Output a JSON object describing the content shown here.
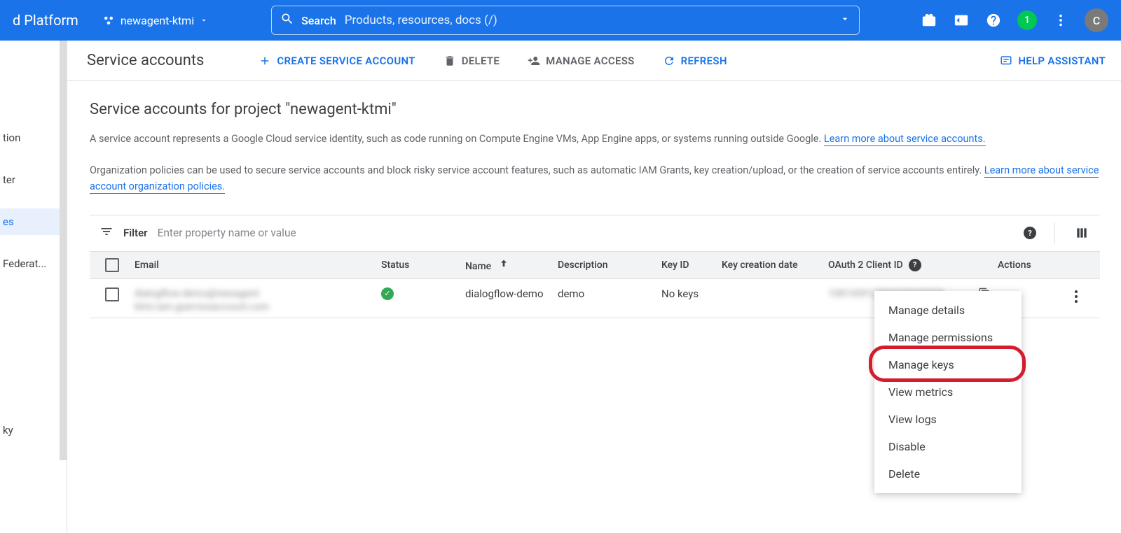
{
  "header": {
    "platform": "d Platform",
    "project": "newagent-ktmi",
    "search_label": "Search",
    "search_placeholder": "Products, resources, docs (/)",
    "notif_count": "1",
    "avatar_letter": "C"
  },
  "sidebar": {
    "items": [
      "tion",
      "ter",
      "es",
      "Federat...",
      "ky"
    ]
  },
  "actionbar": {
    "title": "Service accounts",
    "create": "CREATE SERVICE ACCOUNT",
    "delete": "DELETE",
    "manage_access": "MANAGE ACCESS",
    "refresh": "REFRESH",
    "help": "HELP ASSISTANT"
  },
  "main": {
    "subtitle": "Service accounts for project \"newagent-ktmi\"",
    "desc_text": "A service account represents a Google Cloud service identity, such as code running on Compute Engine VMs, App Engine apps, or systems running outside Google. ",
    "desc_link": "Learn more about service accounts.",
    "desc2_text": "Organization policies can be used to secure service accounts and block risky service account features, such as automatic IAM Grants, key creation/upload, or the creation of service accounts entirely. ",
    "desc2_link": "Learn more about service account organization policies."
  },
  "filter": {
    "label": "Filter",
    "placeholder": "Enter property name or value"
  },
  "table": {
    "columns": {
      "email": "Email",
      "status": "Status",
      "name": "Name",
      "description": "Description",
      "keyid": "Key ID",
      "keydate": "Key creation date",
      "oauth": "OAuth 2 Client ID",
      "actions": "Actions"
    },
    "rows": [
      {
        "email_blur": "dialogflow-demo@newagent ktmi.iam.gserviceaccount.com",
        "name": "dialogflow-demo",
        "description": "demo",
        "keyid": "No keys",
        "oauth_blur": "108143912304030849809"
      }
    ]
  },
  "dropdown": {
    "items": [
      "Manage details",
      "Manage permissions",
      "Manage keys",
      "View metrics",
      "View logs",
      "Disable",
      "Delete"
    ]
  }
}
